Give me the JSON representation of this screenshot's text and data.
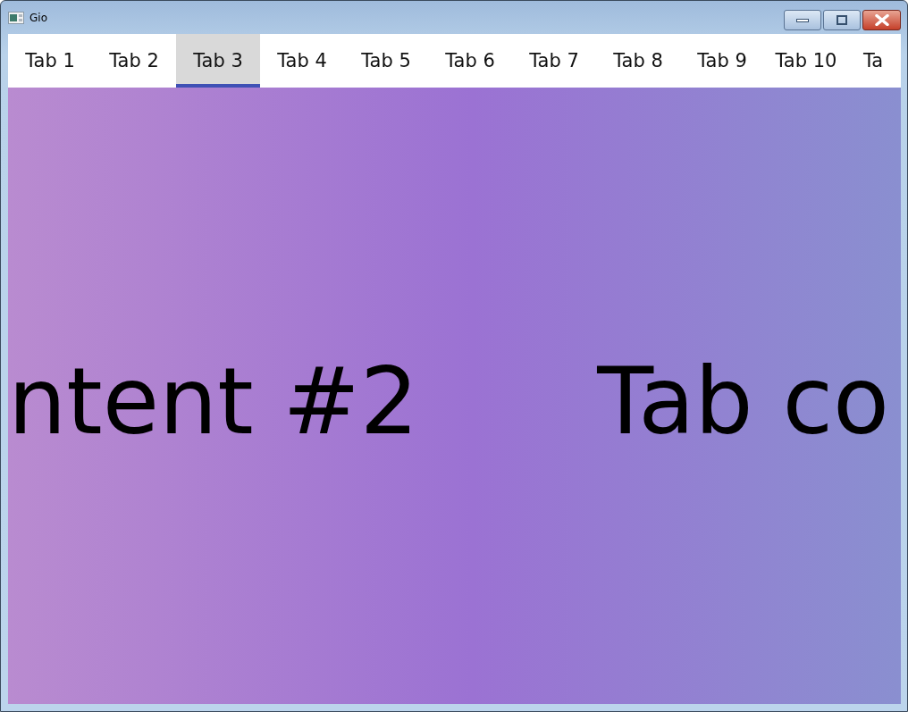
{
  "window": {
    "title": "Gio"
  },
  "tabs": [
    {
      "label": "Tab 1",
      "selected": false
    },
    {
      "label": "Tab 2",
      "selected": false
    },
    {
      "label": "Tab 3",
      "selected": true
    },
    {
      "label": "Tab 4",
      "selected": false
    },
    {
      "label": "Tab 5",
      "selected": false
    },
    {
      "label": "Tab 6",
      "selected": false
    },
    {
      "label": "Tab 7",
      "selected": false
    },
    {
      "label": "Tab 8",
      "selected": false
    },
    {
      "label": "Tab 9",
      "selected": false
    },
    {
      "label": "Tab 10",
      "selected": false
    },
    {
      "label": "Ta",
      "selected": false
    }
  ],
  "content": {
    "texts": [
      "ntent #2",
      "Tab co"
    ]
  }
}
